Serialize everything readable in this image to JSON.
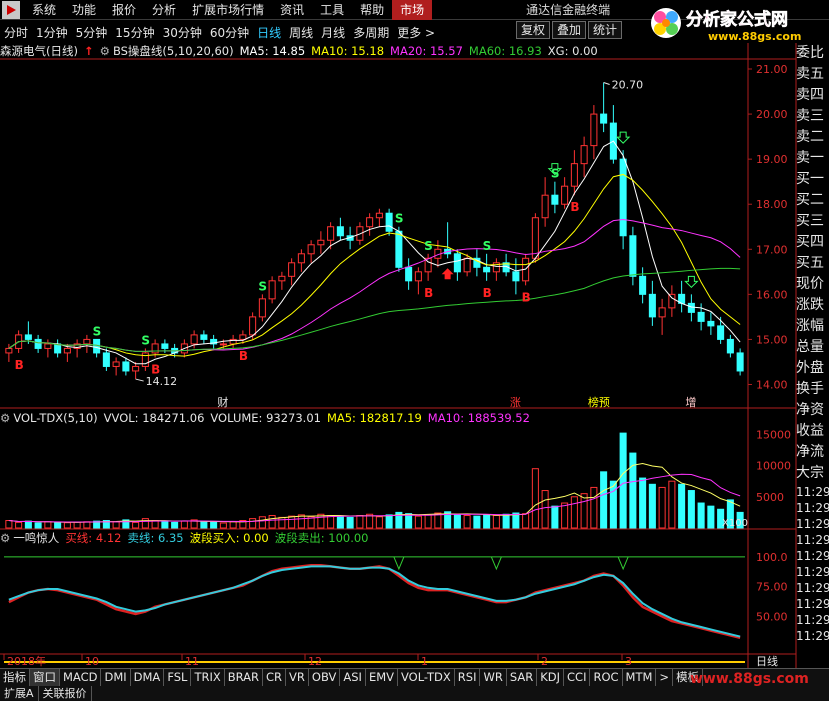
{
  "menu": {
    "items": [
      "系统",
      "功能",
      "报价",
      "分析",
      "扩展市场行情",
      "资讯",
      "工具",
      "帮助",
      "市场"
    ],
    "active_index": 8,
    "right_title": "通达信金融终端"
  },
  "periods": {
    "items": [
      "分时",
      "1分钟",
      "5分钟",
      "15分钟",
      "30分钟",
      "60分钟",
      "日线",
      "周线",
      "月线",
      "多周期",
      "更多 >"
    ],
    "active_index": 6
  },
  "right_buttons": [
    "复权",
    "叠加",
    "统计"
  ],
  "logo": {
    "text": "分析家公式网",
    "url": "www.88gs.com"
  },
  "main": {
    "stock_name": "森源电气(日线)",
    "indicator": "BS操盘线(5,10,20,60)",
    "ma5": "MA5: 14.85",
    "ma10": "MA10: 15.18",
    "ma20": "MA20: 15.57",
    "ma60": "MA60: 16.93",
    "xg": "XG: 0.00",
    "y_labels": [
      "21.00",
      "20.00",
      "19.00",
      "18.00",
      "17.00",
      "16.00",
      "15.00",
      "14.00"
    ],
    "high_label": "20.70",
    "low_label": "14.12",
    "buy_marker": "B",
    "sell_marker": "S",
    "events": [
      "财",
      "涨",
      "榜预",
      "增"
    ]
  },
  "volume": {
    "indicator": "VOL-TDX(5,10)",
    "vvol": "VVOL: 184271.06",
    "volume": "VOLUME: 93273.01",
    "ma5": "MA5: 182817.19",
    "ma10": "MA10: 188539.52",
    "y_labels": [
      "15000",
      "10000",
      "5000"
    ],
    "unit": "X100"
  },
  "osc": {
    "name": "一鸣惊人",
    "buy_line": "买线: 4.12",
    "sell_line": "卖线: 6.35",
    "band_buy": "波段买入: 0.00",
    "band_sell": "波段卖出: 100.00",
    "y_labels": [
      "100.0",
      "75.00",
      "50.00"
    ]
  },
  "x_axis": {
    "labels": [
      "2018年",
      "10",
      "11",
      "12",
      "1",
      "2",
      "3"
    ],
    "right": "日线"
  },
  "right_list": [
    "委比",
    "卖五",
    "卖四",
    "卖三",
    "卖二",
    "卖一",
    "买一",
    "买二",
    "买三",
    "买四",
    "买五",
    "现价",
    "涨跌",
    "涨幅",
    "总量",
    "外盘",
    "换手",
    "净资",
    "收益",
    "净流",
    "大宗",
    "11:29",
    "11:29",
    "11:29",
    "11:29",
    "11:29",
    "11:29",
    "11:29",
    "11:29",
    "11:29",
    "11:29",
    "11:29",
    "11:29",
    "11:30"
  ],
  "tabs": {
    "items": [
      "指标",
      "窗口",
      "MACD",
      "DMI",
      "DMA",
      "FSL",
      "TRIX",
      "BRAR",
      "CR",
      "VR",
      "OBV",
      "ASI",
      "EMV",
      "VOL-TDX",
      "RSI",
      "WR",
      "SAR",
      "KDJ",
      "CCI",
      "ROC",
      "MTM",
      ">",
      "模板"
    ],
    "active_index": 1
  },
  "bottom_tabs": [
    "扩展A",
    "关联报价"
  ],
  "watermark": "www.88gs.com",
  "colors": {
    "up": "#ff3333",
    "down": "#33ffff",
    "ma5": "#ffffff",
    "ma10": "#ffff00",
    "ma20": "#ff33ff",
    "ma60": "#33cc33",
    "buy_line": "#dd2222",
    "sell_line": "#33ccdd"
  },
  "chart_data": {
    "type": "candlestick",
    "price_range": [
      13.7,
      21.2
    ],
    "candles": [
      [
        14.7,
        14.9,
        14.5,
        14.8
      ],
      [
        14.8,
        15.2,
        14.7,
        15.1
      ],
      [
        15.1,
        15.4,
        14.9,
        15.0
      ],
      [
        15.0,
        15.1,
        14.7,
        14.8
      ],
      [
        14.8,
        15.0,
        14.6,
        14.9
      ],
      [
        14.9,
        15.0,
        14.6,
        14.7
      ],
      [
        14.7,
        14.9,
        14.5,
        14.8
      ],
      [
        14.8,
        15.0,
        14.6,
        14.9
      ],
      [
        14.9,
        15.1,
        14.7,
        15.0
      ],
      [
        15.0,
        15.0,
        14.6,
        14.7
      ],
      [
        14.7,
        14.8,
        14.3,
        14.4
      ],
      [
        14.4,
        14.6,
        14.2,
        14.5
      ],
      [
        14.5,
        14.6,
        14.2,
        14.3
      ],
      [
        14.3,
        14.5,
        14.12,
        14.4
      ],
      [
        14.4,
        14.8,
        14.3,
        14.7
      ],
      [
        14.7,
        15.0,
        14.6,
        14.9
      ],
      [
        14.9,
        15.0,
        14.7,
        14.8
      ],
      [
        14.8,
        14.9,
        14.6,
        14.7
      ],
      [
        14.7,
        15.0,
        14.6,
        14.9
      ],
      [
        14.9,
        15.2,
        14.8,
        15.1
      ],
      [
        15.1,
        15.2,
        14.9,
        15.0
      ],
      [
        15.0,
        15.1,
        14.8,
        14.9
      ],
      [
        14.9,
        15.0,
        14.8,
        14.9
      ],
      [
        14.9,
        15.1,
        14.8,
        15.0
      ],
      [
        15.0,
        15.2,
        14.9,
        15.1
      ],
      [
        15.1,
        15.6,
        15.0,
        15.5
      ],
      [
        15.5,
        16.0,
        15.4,
        15.9
      ],
      [
        15.9,
        16.4,
        15.8,
        16.3
      ],
      [
        16.3,
        16.5,
        16.1,
        16.4
      ],
      [
        16.4,
        16.8,
        16.2,
        16.7
      ],
      [
        16.7,
        17.0,
        16.5,
        16.9
      ],
      [
        16.9,
        17.2,
        16.7,
        17.1
      ],
      [
        17.1,
        17.4,
        16.9,
        17.2
      ],
      [
        17.2,
        17.6,
        17.0,
        17.5
      ],
      [
        17.5,
        17.7,
        17.2,
        17.3
      ],
      [
        17.3,
        17.5,
        17.0,
        17.2
      ],
      [
        17.2,
        17.6,
        17.1,
        17.5
      ],
      [
        17.5,
        17.8,
        17.3,
        17.7
      ],
      [
        17.7,
        17.9,
        17.5,
        17.8
      ],
      [
        17.8,
        17.9,
        17.3,
        17.4
      ],
      [
        17.4,
        17.5,
        16.5,
        16.6
      ],
      [
        16.6,
        16.8,
        16.1,
        16.3
      ],
      [
        16.3,
        16.6,
        16.0,
        16.5
      ],
      [
        16.5,
        16.9,
        16.3,
        16.8
      ],
      [
        16.8,
        17.2,
        16.6,
        17.0
      ],
      [
        17.0,
        17.6,
        16.8,
        16.9
      ],
      [
        16.9,
        17.0,
        16.3,
        16.5
      ],
      [
        16.5,
        16.9,
        16.4,
        16.8
      ],
      [
        16.8,
        17.0,
        16.4,
        16.6
      ],
      [
        16.6,
        16.9,
        16.3,
        16.5
      ],
      [
        16.5,
        16.8,
        16.3,
        16.7
      ],
      [
        16.7,
        16.9,
        16.4,
        16.5
      ],
      [
        16.5,
        16.8,
        16.0,
        16.3
      ],
      [
        16.3,
        16.9,
        16.2,
        16.8
      ],
      [
        16.8,
        17.8,
        16.7,
        17.7
      ],
      [
        17.7,
        18.6,
        17.5,
        18.2
      ],
      [
        18.2,
        18.5,
        17.8,
        18.0
      ],
      [
        18.0,
        18.6,
        17.9,
        18.4
      ],
      [
        18.4,
        19.2,
        18.2,
        18.9
      ],
      [
        18.9,
        19.5,
        18.6,
        19.3
      ],
      [
        19.3,
        20.2,
        19.0,
        20.0
      ],
      [
        20.0,
        20.7,
        19.6,
        19.8
      ],
      [
        19.8,
        20.2,
        18.9,
        19.0
      ],
      [
        19.0,
        19.2,
        17.0,
        17.3
      ],
      [
        17.3,
        17.5,
        16.2,
        16.4
      ],
      [
        16.4,
        16.6,
        15.8,
        16.0
      ],
      [
        16.0,
        16.3,
        15.3,
        15.5
      ],
      [
        15.5,
        15.9,
        15.1,
        15.7
      ],
      [
        15.7,
        16.2,
        15.5,
        16.0
      ],
      [
        16.0,
        16.3,
        15.6,
        15.8
      ],
      [
        15.8,
        16.0,
        15.4,
        15.6
      ],
      [
        15.6,
        15.8,
        15.2,
        15.4
      ],
      [
        15.4,
        15.6,
        15.1,
        15.3
      ],
      [
        15.3,
        15.5,
        14.9,
        15.0
      ],
      [
        15.0,
        15.1,
        14.6,
        14.7
      ],
      [
        14.7,
        14.8,
        14.2,
        14.3
      ]
    ],
    "volumes": [
      1200,
      900,
      1100,
      800,
      1000,
      900,
      850,
      950,
      1000,
      1100,
      1200,
      1000,
      1300,
      900,
      1500,
      1200,
      1000,
      900,
      1100,
      1300,
      1000,
      900,
      800,
      1000,
      1200,
      1500,
      1800,
      2000,
      1700,
      1900,
      2100,
      1800,
      2200,
      2000,
      1900,
      1700,
      2000,
      2200,
      1800,
      2100,
      2500,
      2300,
      1900,
      2100,
      2400,
      2600,
      2200,
      2000,
      1900,
      2100,
      2000,
      2200,
      2400,
      2300,
      9500,
      6000,
      3500,
      4000,
      5000,
      5500,
      6500,
      9000,
      7500,
      15200,
      12000,
      8000,
      7000,
      6500,
      7500,
      7000,
      6000,
      4000,
      3500,
      3000,
      4500,
      2500
    ],
    "buy_line": [
      62,
      66,
      70,
      72,
      73,
      72,
      70,
      68,
      66,
      64,
      60,
      56,
      54,
      52,
      54,
      58,
      60,
      62,
      64,
      66,
      68,
      70,
      72,
      74,
      76,
      80,
      84,
      88,
      90,
      91,
      92,
      93,
      93,
      92,
      91,
      90,
      90,
      91,
      92,
      90,
      84,
      78,
      74,
      72,
      72,
      72,
      70,
      68,
      66,
      64,
      62,
      62,
      64,
      66,
      70,
      72,
      74,
      76,
      78,
      80,
      84,
      86,
      84,
      76,
      66,
      58,
      54,
      50,
      46,
      44,
      42,
      40,
      38,
      36,
      34,
      32
    ],
    "sell_line": [
      64,
      67,
      70,
      72,
      73,
      73,
      71,
      69,
      67,
      65,
      62,
      58,
      56,
      54,
      55,
      57,
      60,
      62,
      64,
      66,
      68,
      70,
      72,
      74,
      77,
      80,
      84,
      87,
      89,
      90,
      91,
      92,
      92,
      92,
      91,
      90,
      90,
      91,
      91,
      90,
      86,
      80,
      76,
      74,
      73,
      73,
      71,
      69,
      67,
      65,
      63,
      63,
      64,
      66,
      69,
      71,
      73,
      75,
      77,
      80,
      83,
      85,
      84,
      78,
      69,
      61,
      56,
      52,
      48,
      45,
      43,
      41,
      39,
      37,
      35,
      33
    ]
  }
}
